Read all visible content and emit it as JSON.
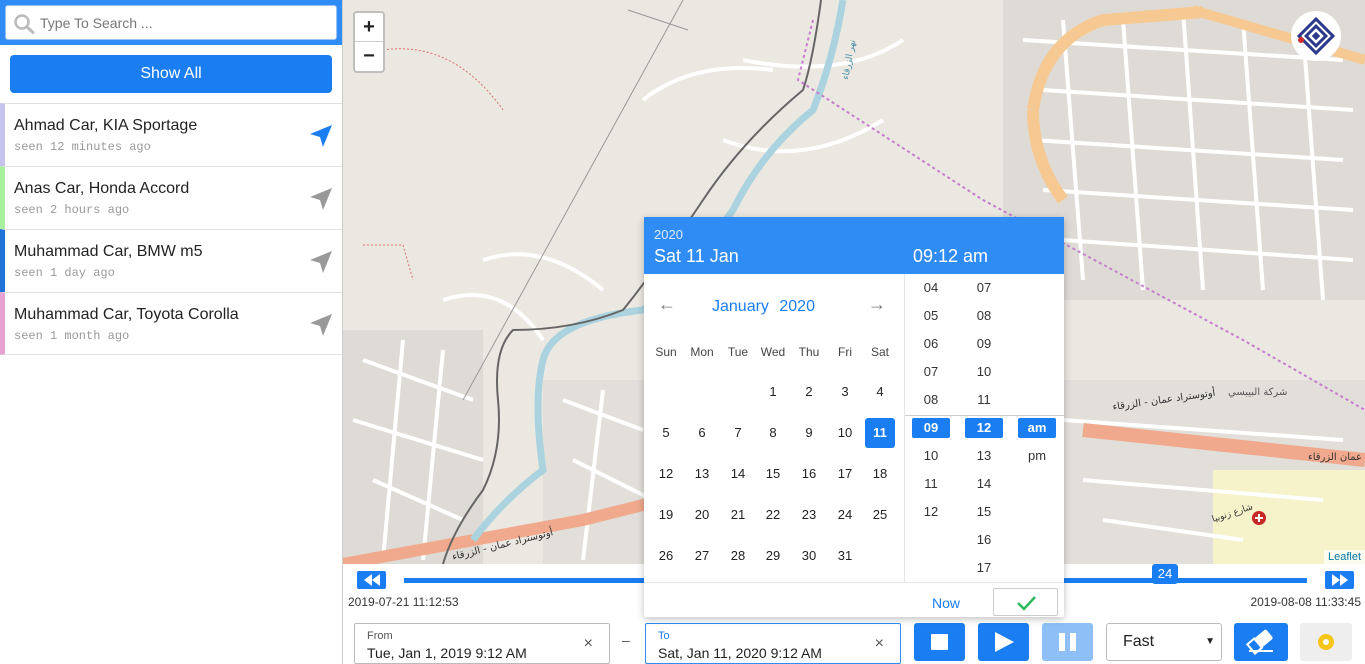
{
  "search": {
    "placeholder": "Type To Search ..."
  },
  "show_all_label": "Show All",
  "vehicles": [
    {
      "name": "Ahmad Car, KIA Sportage",
      "seen": "seen 12 minutes ago",
      "color": "#c7c3f0",
      "active": true
    },
    {
      "name": "Anas Car, Honda Accord",
      "seen": "seen 2 hours ago",
      "color": "#a9ef9f",
      "active": false
    },
    {
      "name": "Muhammad Car, BMW m5",
      "seen": "seen 1 day ago",
      "color": "#1f72d8",
      "active": false
    },
    {
      "name": "Muhammad Car, Toyota Corolla",
      "seen": "seen 1 month ago",
      "color": "#e6a2d2",
      "active": false
    }
  ],
  "map": {
    "zoom_in": "+",
    "zoom_out": "−",
    "attribution": "Leaflet",
    "labels": {
      "road1": "أوتوستراد عمان - الزرقاء",
      "road2": "أوتوستراد عمان - الزرقاء",
      "road3": "أوتوستراد عمان الزرقاء",
      "river": "نهر الزرقاء",
      "company": "شركة البيبسي",
      "street": "شارع زنوبيا"
    }
  },
  "timeline": {
    "start": "2019-07-21 11:12:53",
    "end": "2019-08-08 11:33:45",
    "position": "24",
    "rewind_icon": "fast-rewind-icon",
    "forward_icon": "fast-forward-icon"
  },
  "range": {
    "from_label": "From",
    "from_value": "Tue, Jan 1, 2019 9:12 AM",
    "to_label": "To",
    "to_value": "Sat, Jan 11, 2020 9:12 AM",
    "clear_glyph": "×",
    "dash": "–"
  },
  "speed": {
    "selected": "Fast"
  },
  "picker": {
    "year": "2020",
    "date": "Sat 11 Jan",
    "time": "09:12 am",
    "month": "January",
    "month_year": "2020",
    "prev": "←",
    "next": "→",
    "weekdays": [
      "Sun",
      "Mon",
      "Tue",
      "Wed",
      "Thu",
      "Fri",
      "Sat"
    ],
    "weeks": [
      [
        "",
        "",
        "",
        "1",
        "2",
        "3",
        "4"
      ],
      [
        "5",
        "6",
        "7",
        "8",
        "9",
        "10",
        "11"
      ],
      [
        "12",
        "13",
        "14",
        "15",
        "16",
        "17",
        "18"
      ],
      [
        "19",
        "20",
        "21",
        "22",
        "23",
        "24",
        "25"
      ],
      [
        "26",
        "27",
        "28",
        "29",
        "30",
        "31",
        ""
      ]
    ],
    "selected_day": "11",
    "hours": [
      "04",
      "05",
      "06",
      "07",
      "08",
      "09",
      "10",
      "11",
      "12"
    ],
    "minutes": [
      "07",
      "08",
      "09",
      "10",
      "11",
      "12",
      "13",
      "14",
      "15",
      "16",
      "17"
    ],
    "ampm": [
      "am",
      "pm"
    ],
    "selected_hour": "09",
    "selected_minute": "12",
    "selected_ampm": "am",
    "now_label": "Now"
  },
  "colors": {
    "accent": "#1a7ef2",
    "header": "#2f8cf5",
    "road_major": "#f0a98c",
    "river": "#aad3df"
  }
}
